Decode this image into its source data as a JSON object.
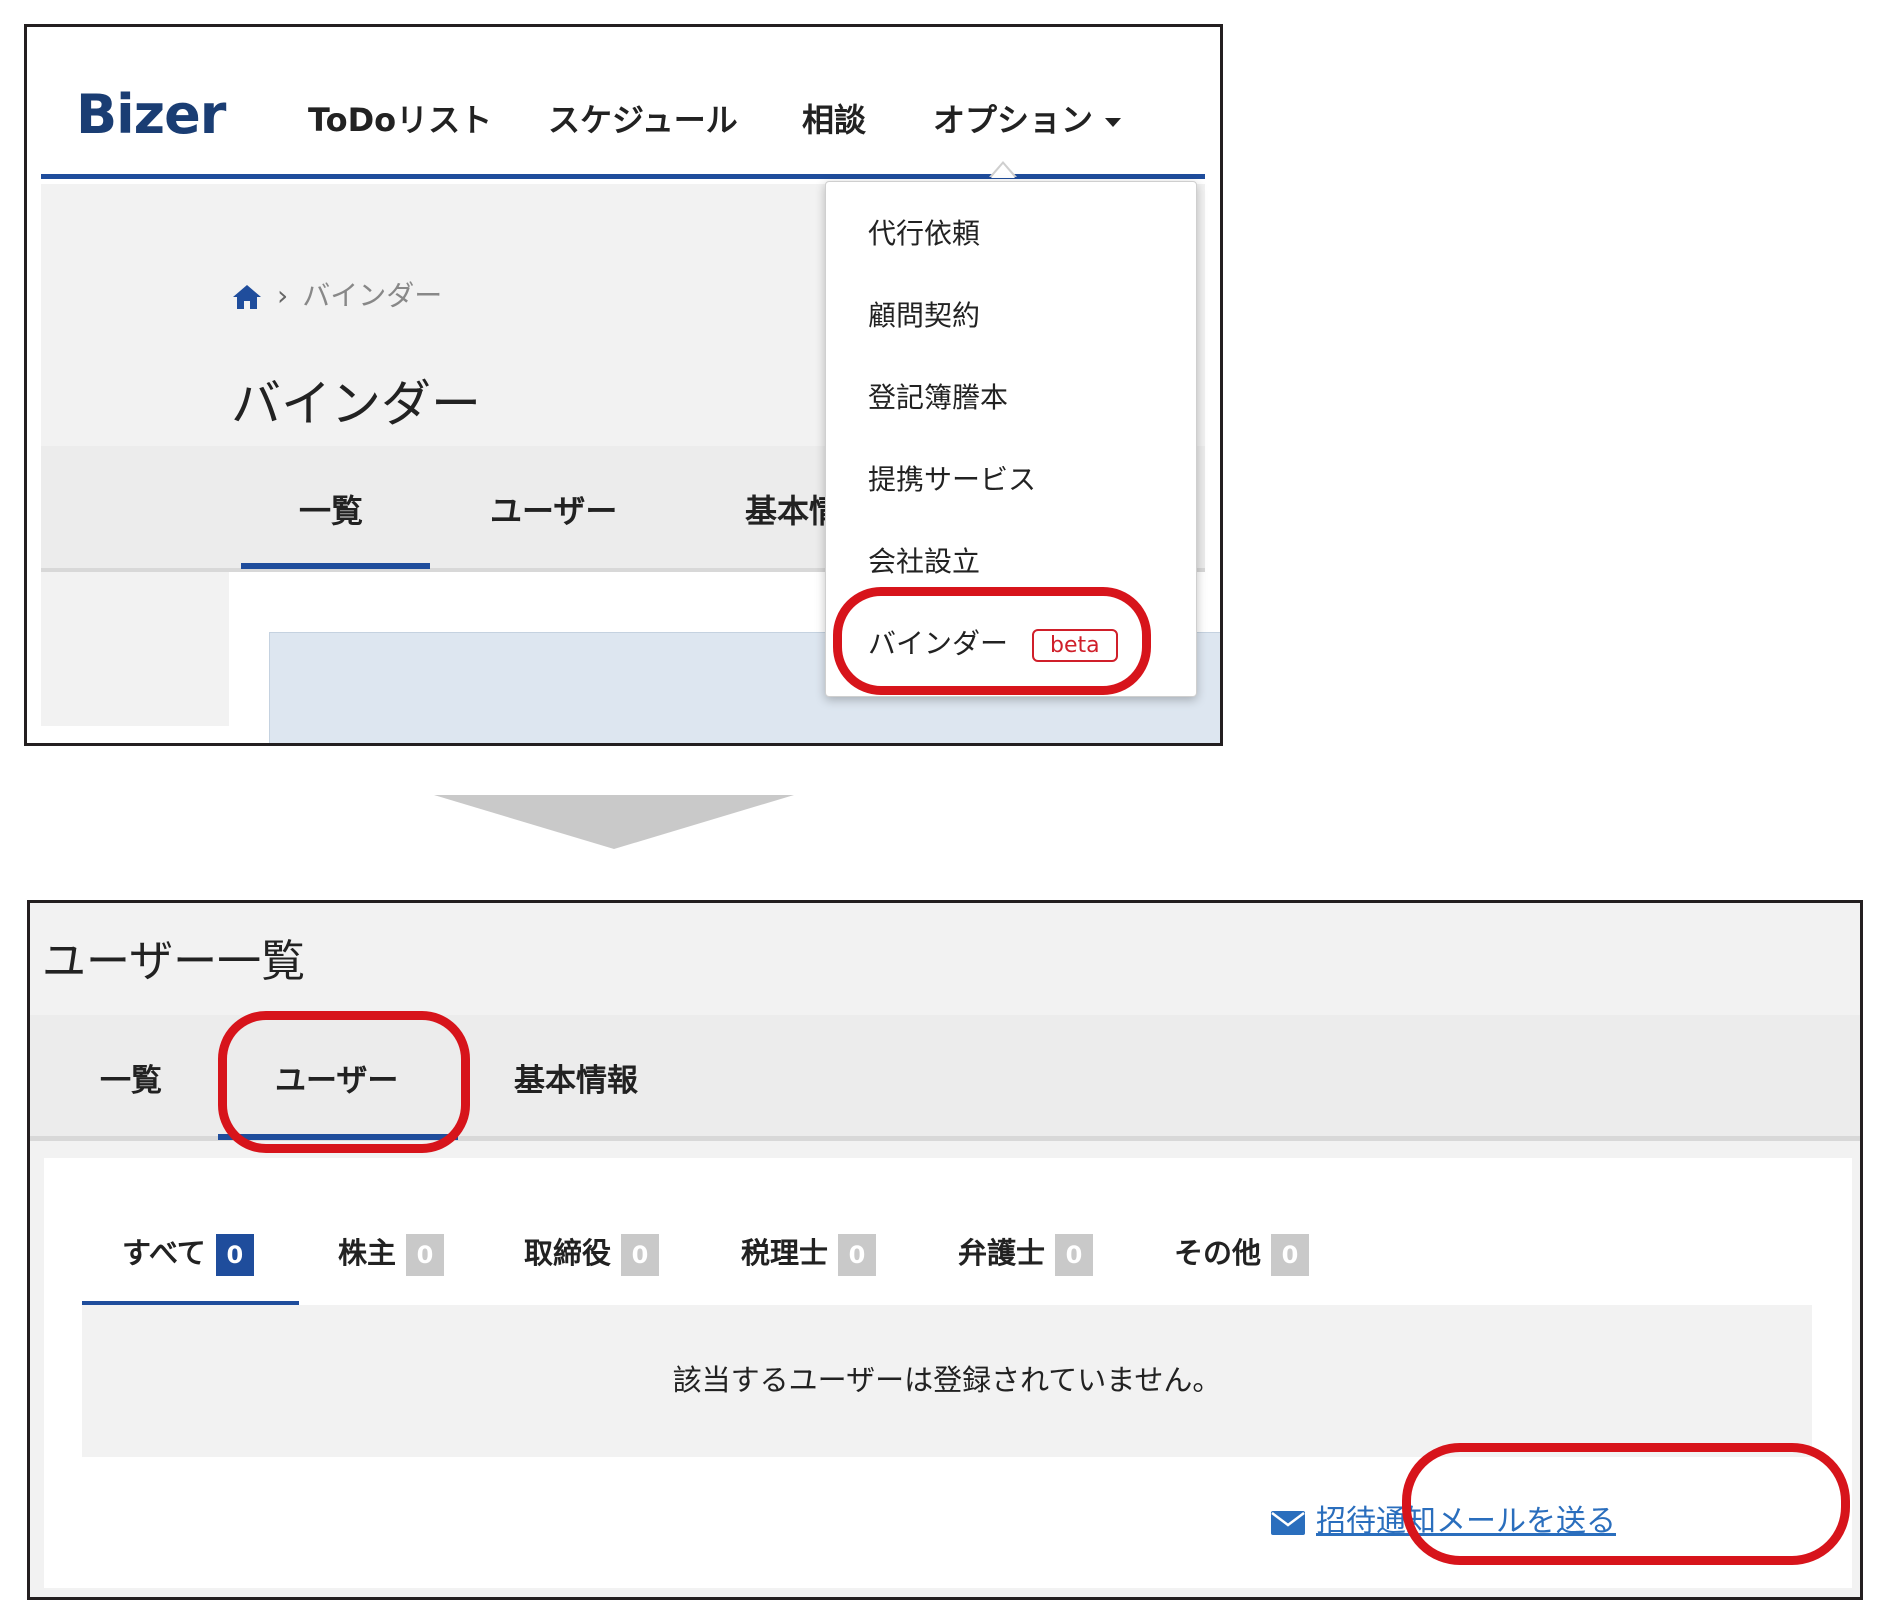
{
  "screen1": {
    "logo": "Bizer",
    "nav": {
      "todo": "ToDoリスト",
      "schedule": "スケジュール",
      "consult": "相談",
      "options": "オプション"
    },
    "breadcrumb": {
      "current": "バインダー"
    },
    "page_title": "バインダー",
    "tabs": [
      "一覧",
      "ユーザー",
      "基本情"
    ],
    "dropdown": {
      "items": [
        "代行依頼",
        "顧問契約",
        "登記簿謄本",
        "提携サービス",
        "会社設立",
        "バインダー"
      ],
      "badge": "beta"
    }
  },
  "screen2": {
    "page_title": "ユーザー一覧",
    "tabs": [
      "一覧",
      "ユーザー",
      "基本情報"
    ],
    "filter_tabs": [
      {
        "label": "すべて",
        "count": "0"
      },
      {
        "label": "株主",
        "count": "0"
      },
      {
        "label": "取締役",
        "count": "0"
      },
      {
        "label": "税理士",
        "count": "0"
      },
      {
        "label": "弁護士",
        "count": "0"
      },
      {
        "label": "その他",
        "count": "0"
      }
    ],
    "empty_message": "該当するユーザーは登録されていません。",
    "invite_link": "招待通知メールを送る"
  },
  "colors": {
    "accent": "#1f4d9c",
    "highlight": "#d7141b",
    "link": "#2a6ebd"
  },
  "icons": {
    "home": "home-icon",
    "mail": "envelope-icon",
    "caret": "caret-down-icon",
    "arrow": "down-arrow-icon"
  }
}
